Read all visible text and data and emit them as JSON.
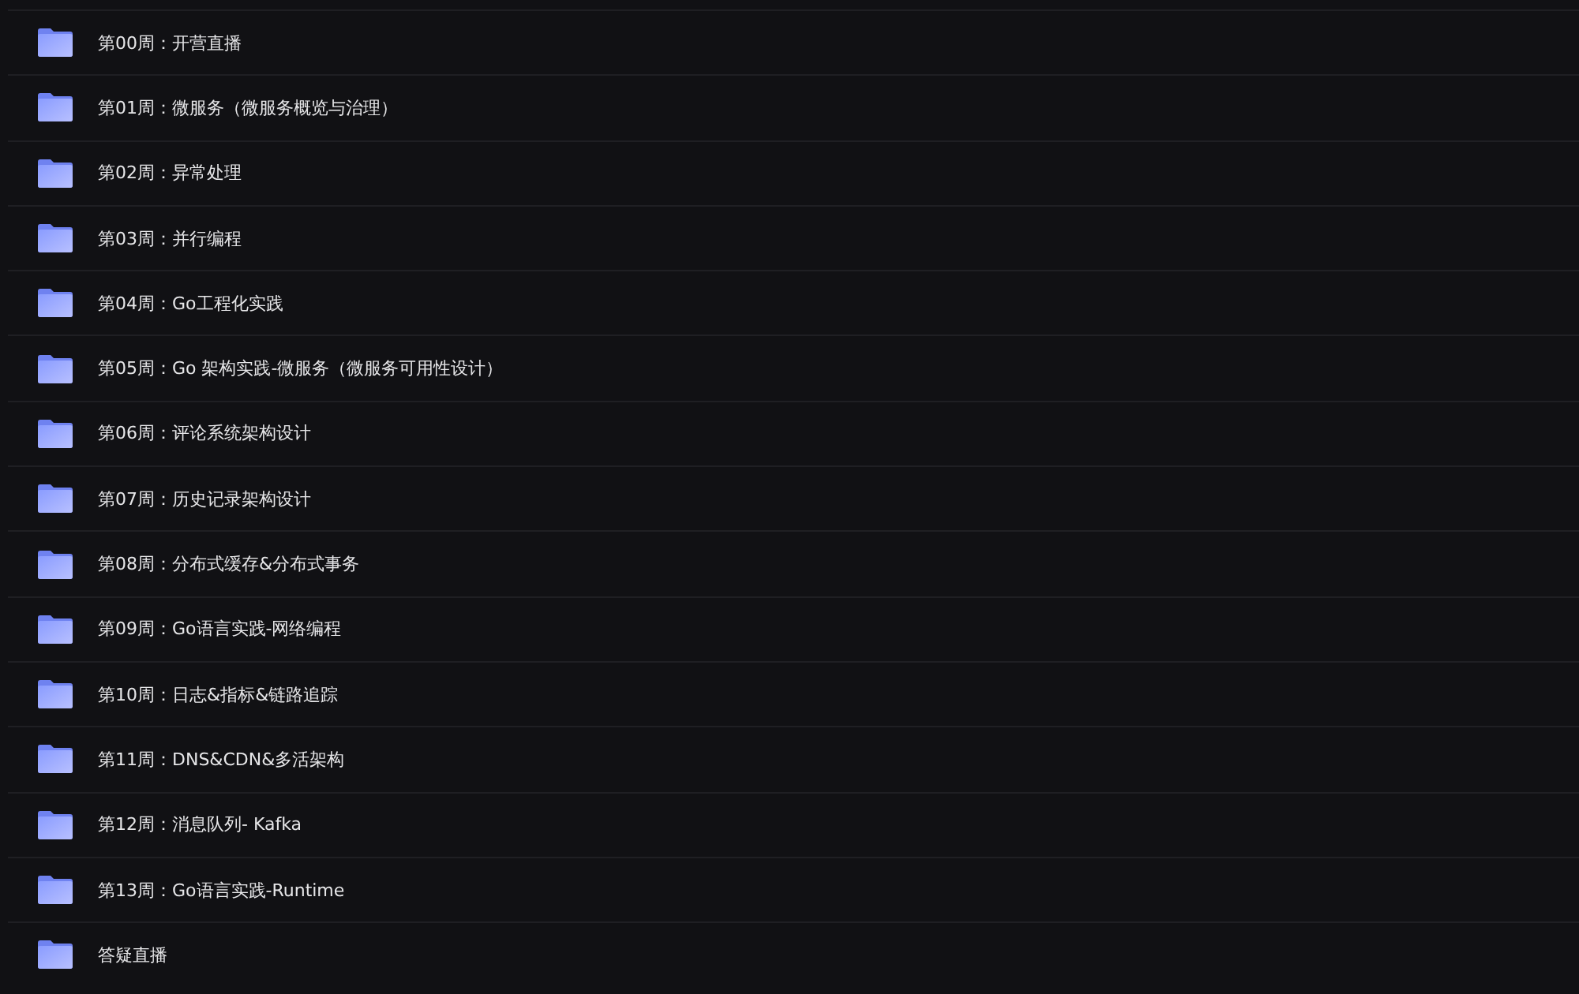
{
  "folders": [
    {
      "name": "第00周：开营直播"
    },
    {
      "name": "第01周：微服务（微服务概览与治理）"
    },
    {
      "name": "第02周：异常处理"
    },
    {
      "name": "第03周：并行编程"
    },
    {
      "name": "第04周：Go工程化实践"
    },
    {
      "name": "第05周：Go 架构实践-微服务（微服务可用性设计）"
    },
    {
      "name": "第06周：评论系统架构设计"
    },
    {
      "name": "第07周：历史记录架构设计"
    },
    {
      "name": "第08周：分布式缓存&分布式事务"
    },
    {
      "name": "第09周：Go语言实践-网络编程"
    },
    {
      "name": "第10周：日志&指标&链路追踪"
    },
    {
      "name": "第11周：DNS&CDN&多活架构"
    },
    {
      "name": "第12周：消息队列- Kafka"
    },
    {
      "name": "第13周：Go语言实践-Runtime"
    },
    {
      "name": "答疑直播"
    }
  ]
}
